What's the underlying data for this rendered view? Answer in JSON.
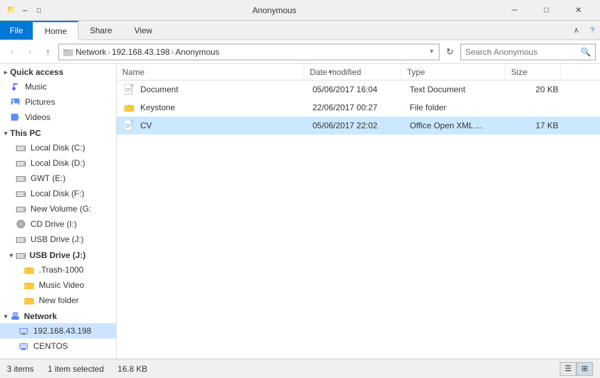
{
  "titleBar": {
    "title": "Anonymous",
    "icons": [
      "📁",
      "📌",
      "📌"
    ],
    "controls": {
      "minimize": "─",
      "restore": "□",
      "close": "✕"
    }
  },
  "ribbon": {
    "tabs": [
      {
        "id": "file",
        "label": "File"
      },
      {
        "id": "home",
        "label": "Home"
      },
      {
        "id": "share",
        "label": "Share"
      },
      {
        "id": "view",
        "label": "View"
      }
    ],
    "activeTab": "home"
  },
  "addressBar": {
    "segments": [
      "Network",
      "192.168.43.198",
      "Anonymous"
    ],
    "searchPlaceholder": "Search Anonymous"
  },
  "nav": {
    "back": "‹",
    "forward": "›",
    "up": "↑"
  },
  "sidebar": {
    "quickAccess": [
      {
        "id": "music",
        "label": "Music",
        "icon": "music"
      },
      {
        "id": "pictures",
        "label": "Pictures",
        "icon": "pictures"
      },
      {
        "id": "videos",
        "label": "Videos",
        "icon": "videos"
      }
    ],
    "thisPC": [
      {
        "id": "localC",
        "label": "Local Disk (C:)",
        "icon": "disk"
      },
      {
        "id": "localD",
        "label": "Local Disk (D:)",
        "icon": "disk"
      },
      {
        "id": "gwtE",
        "label": "GWT (E:)",
        "icon": "disk"
      },
      {
        "id": "localF",
        "label": "Local Disk (F:)",
        "icon": "disk"
      },
      {
        "id": "newVolG",
        "label": "New Volume (G:)",
        "icon": "disk"
      },
      {
        "id": "cdI",
        "label": "CD Drive (I:)",
        "icon": "cd"
      },
      {
        "id": "usbJ1",
        "label": "USB Drive (J:)",
        "icon": "usb"
      }
    ],
    "usbJ": {
      "label": "USB Drive (J:)",
      "children": [
        {
          "id": "trash",
          "label": ".Trash-1000",
          "icon": "folder"
        },
        {
          "id": "musicvid",
          "label": "Music Video",
          "icon": "folder"
        },
        {
          "id": "newfolder",
          "label": "New folder",
          "icon": "folder"
        }
      ]
    },
    "network": {
      "label": "Network",
      "children": [
        {
          "id": "ip198",
          "label": "192.168.43.198",
          "icon": "pc",
          "selected": true
        },
        {
          "id": "centos",
          "label": "CENTOS",
          "icon": "pc"
        }
      ]
    }
  },
  "fileList": {
    "columns": [
      {
        "id": "name",
        "label": "Name"
      },
      {
        "id": "date",
        "label": "Date modified"
      },
      {
        "id": "type",
        "label": "Type"
      },
      {
        "id": "size",
        "label": "Size"
      }
    ],
    "files": [
      {
        "id": 1,
        "name": "Document",
        "date": "05/06/2017 16:04",
        "type": "Text Document",
        "size": "20 KB",
        "icon": "doc",
        "selected": false
      },
      {
        "id": 2,
        "name": "Keystone",
        "date": "22/06/2017 00:27",
        "type": "File folder",
        "size": "",
        "icon": "folder",
        "selected": false
      },
      {
        "id": 3,
        "name": "CV",
        "date": "05/06/2017 22:02",
        "type": "Office Open XML ...",
        "size": "17 KB",
        "icon": "office",
        "selected": true
      }
    ]
  },
  "statusBar": {
    "count": "3 items",
    "selected": "1 item selected",
    "size": "16.8 KB"
  }
}
